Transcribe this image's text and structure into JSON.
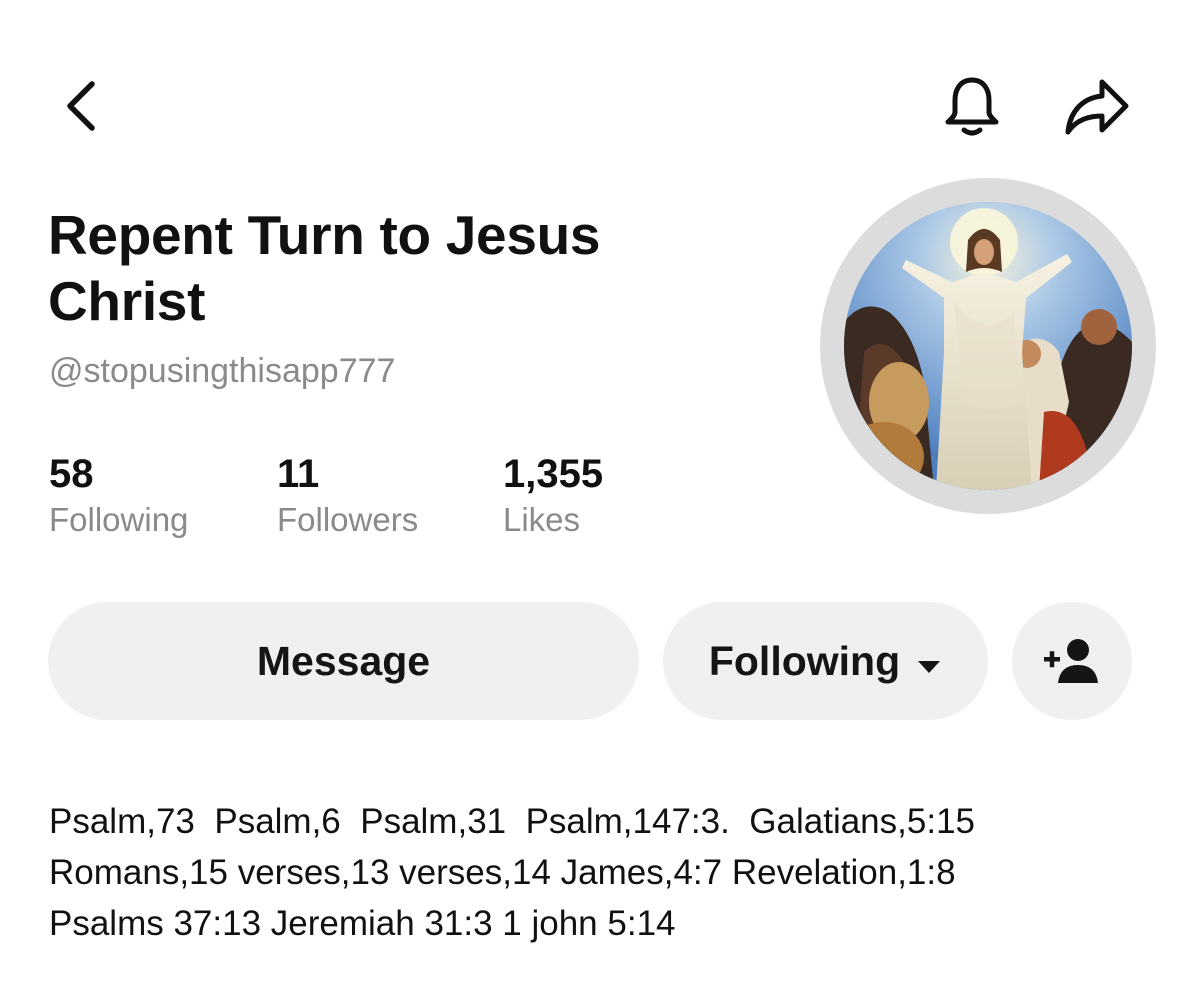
{
  "header": {
    "back_icon": "chevron-left-icon",
    "bell_icon": "bell-icon",
    "share_icon": "share-arrow-icon"
  },
  "profile": {
    "display_name": "Repent Turn to Jesus Christ",
    "handle": "@stopusingthisapp777",
    "avatar": "painting-of-jesus-with-outstretched-arms"
  },
  "stats": {
    "following": {
      "value": "58",
      "label": "Following"
    },
    "followers": {
      "value": "11",
      "label": "Followers"
    },
    "likes": {
      "value": "1,355",
      "label": "Likes"
    }
  },
  "actions": {
    "message_label": "Message",
    "following_label": "Following",
    "following_icon": "caret-down-icon",
    "add_friend_icon": "add-person-icon"
  },
  "bio": {
    "lines": [
      "Psalm,73  Psalm,6  Psalm,31  Psalm,147:3.  Galatians,5:15",
      "Romans,15 verses,13 verses,14 James,4:7 Revelation,1:8",
      "Psalms 37:13 Jeremiah 31:3 1 john 5:14"
    ]
  },
  "colors": {
    "text": "#111111",
    "muted": "#8a8a8a",
    "button_bg": "#f0f0f0",
    "avatar_ring": "#dcdcdc"
  }
}
